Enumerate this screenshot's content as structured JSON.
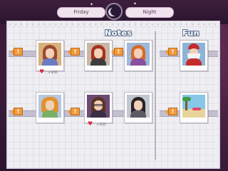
{
  "topbar": {
    "left_label": "Friday",
    "right_label": "Night"
  },
  "sections": {
    "notes_title": "Notes",
    "fun_title": "Fun"
  },
  "notes_row1": [
    {
      "name": "character-short-brown-hair",
      "marker": "!",
      "stat": "x 0/50",
      "hair": "#9b4a2f",
      "bg": "#d7b27c",
      "body": "#6b7cc4",
      "has_heart": true
    },
    {
      "name": "character-red-hair",
      "marker": "!",
      "stat": "",
      "hair": "#a8311d",
      "bg": "#c8b7a7",
      "body": "#3d3d3d",
      "has_heart": false
    },
    {
      "name": "character-ginger-hair",
      "marker": "!",
      "stat": "",
      "hair": "#d46b2a",
      "bg": "#9db8d9",
      "body": "#8a4f9d",
      "has_heart": false
    }
  ],
  "notes_row2": [
    {
      "name": "character-blonde-curly",
      "marker": "!",
      "stat": "",
      "hair": "#e0932d",
      "bg": "#b6c7df",
      "body": "#7ab063",
      "has_heart": false
    },
    {
      "name": "character-glasses",
      "marker": "!",
      "stat": "x 0/20",
      "hair": "#5b3325",
      "bg": "#6c4a74",
      "body": "#3b2f45",
      "has_heart": true
    },
    {
      "name": "character-dark-long-hair",
      "marker": "",
      "stat": "",
      "hair": "#2a2426",
      "bg": "#c2c7d1",
      "body": "#5e5b66",
      "has_heart": false
    }
  ],
  "fun_row1": {
    "name": "santa-card",
    "marker": "!",
    "hair": "#f4f4f4",
    "bg": "#8fb3d6",
    "body": "#c62b2b"
  },
  "fun_row2": {
    "name": "beach-card",
    "marker": "!",
    "bg_top": "#87c7e8",
    "bg_bottom": "#e8d49b"
  }
}
